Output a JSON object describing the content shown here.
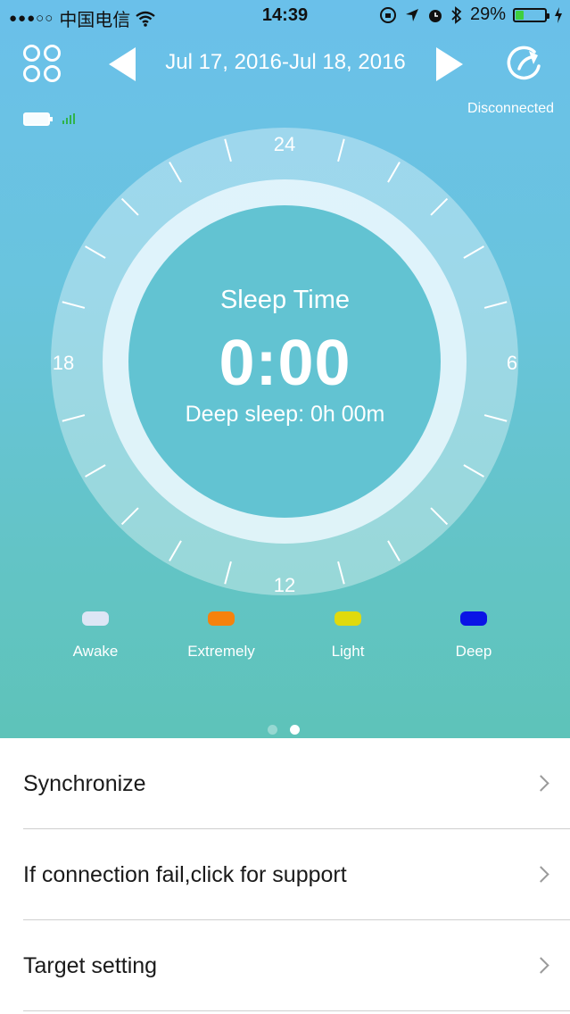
{
  "status_bar": {
    "carrier": "中国电信",
    "time": "14:39",
    "battery_percent": "29%",
    "battery_level": 0.29
  },
  "header": {
    "date_range": "Jul 17, 2016-Jul 18, 2016",
    "connection_status": "Disconnected"
  },
  "dial": {
    "hour_labels": {
      "top": "24",
      "right": "6",
      "bottom": "12",
      "left": "18"
    },
    "title": "Sleep Time",
    "value": "0:00",
    "subtitle": "Deep sleep: 0h 00m"
  },
  "legend": [
    {
      "label": "Awake",
      "color": "#dde6f5"
    },
    {
      "label": "Extremely",
      "color": "#f5820d"
    },
    {
      "label": "Light",
      "color": "#e0da0d"
    },
    {
      "label": "Deep",
      "color": "#0a14e6"
    }
  ],
  "pager": {
    "pages": 2,
    "active_page": 2
  },
  "menu": [
    {
      "label": "Synchronize"
    },
    {
      "label": "If connection fail,click for support"
    },
    {
      "label": "Target setting"
    }
  ],
  "icons": {
    "menu": "grid-icon",
    "prev": "chevron-left-icon",
    "next": "chevron-right-icon",
    "share": "share-icon",
    "device_battery": "battery-icon",
    "signal": "signal-icon"
  }
}
